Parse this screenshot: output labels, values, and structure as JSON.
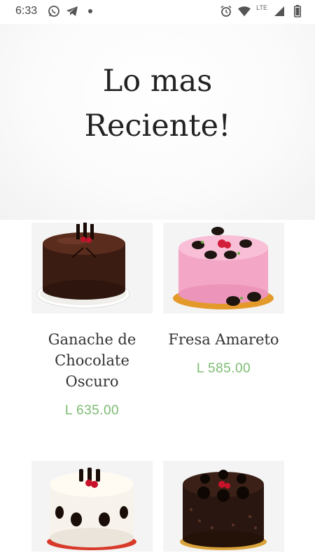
{
  "status_bar": {
    "time": "6:33",
    "network": "LTE",
    "icons": [
      "whatsapp-icon",
      "telegram-icon",
      "dot-icon",
      "alarm-icon",
      "wifi-icon",
      "signal-icon",
      "battery-icon"
    ]
  },
  "page": {
    "title_line1": "Lo mas",
    "title_line2": "Reciente!"
  },
  "products": [
    {
      "name": "Ganache de Chocolate Oscuro",
      "price": "L 635.00",
      "image": "chocolate-ganache-cake"
    },
    {
      "name": "Fresa Amareto",
      "price": "L 585.00",
      "image": "pink-strawberry-cake"
    },
    {
      "name": "",
      "price": "",
      "image": "white-cake-chocolate-decor"
    },
    {
      "name": "",
      "price": "",
      "image": "chocolate-shaving-cake"
    }
  ],
  "colors": {
    "price": "#7dbb72",
    "title": "#222222",
    "background": "#ffffff"
  }
}
